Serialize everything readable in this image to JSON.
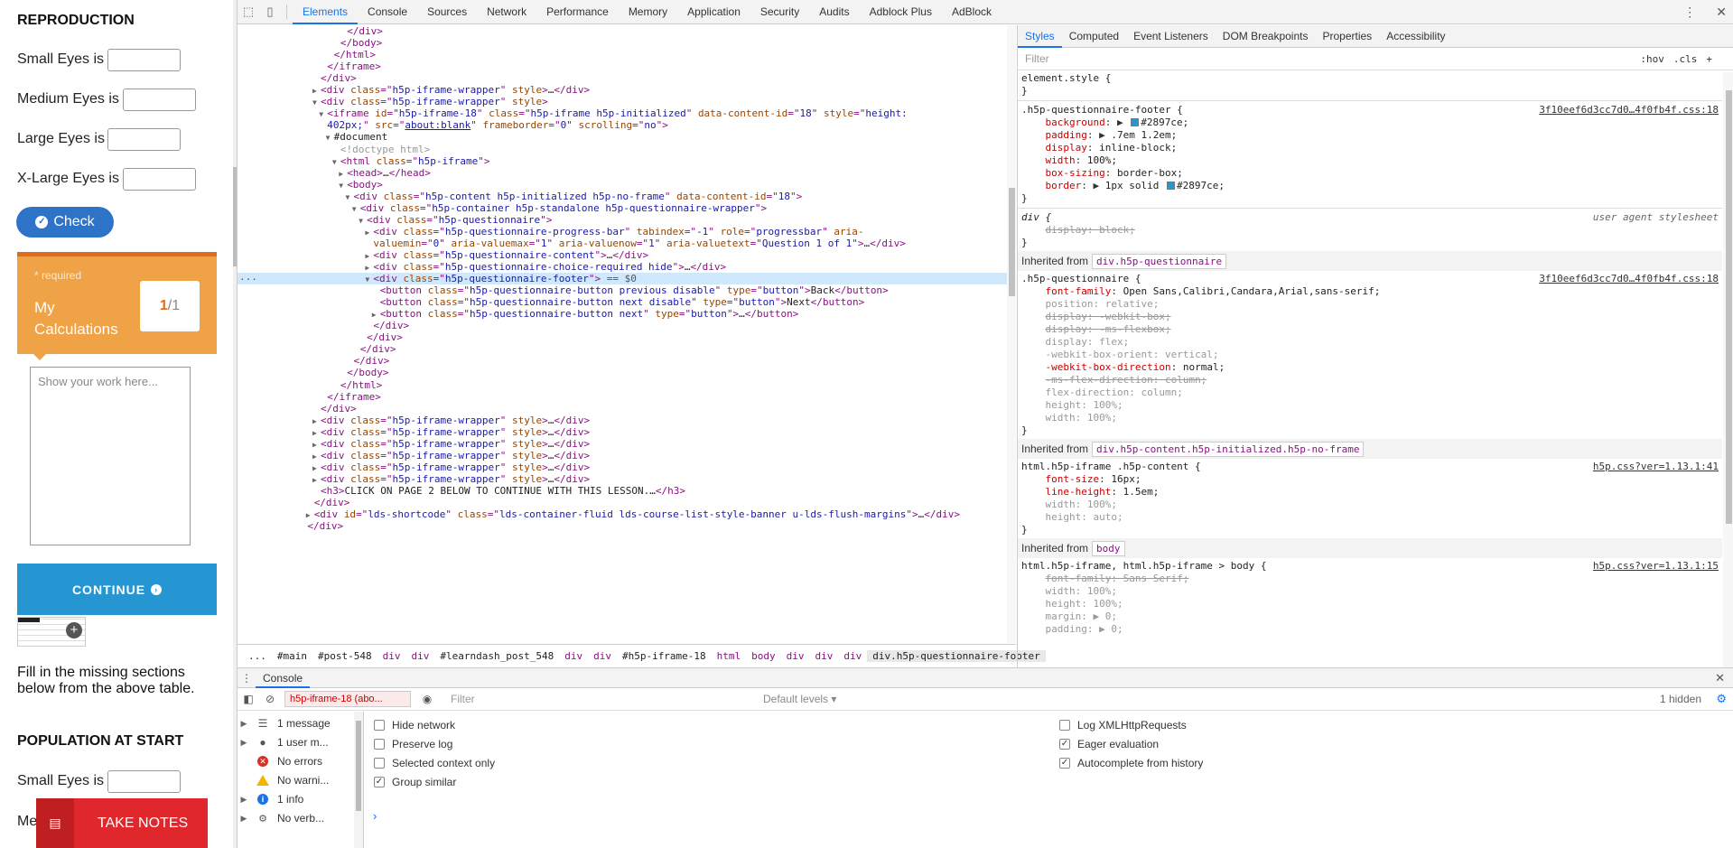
{
  "page": {
    "reproduction_heading": "REPRODUCTION",
    "rows": [
      {
        "label": "Small Eyes is",
        "value": ""
      },
      {
        "label": "Medium Eyes is",
        "value": ""
      },
      {
        "label": "Large Eyes is",
        "value": ""
      },
      {
        "label": "X-Large Eyes is",
        "value": ""
      }
    ],
    "check_label": "Check",
    "calc_card": {
      "required": "* required",
      "title": "My Calculations",
      "current": "1",
      "sep": "/",
      "total": "1"
    },
    "work_placeholder": "Show your work here...",
    "continue_label": "CONTINUE",
    "fill_text": "Fill in the missing sections below from the above table.",
    "population_heading": "POPULATION AT START",
    "pop_rows": [
      {
        "label": "Small Eyes is",
        "value": ""
      },
      {
        "label": "Me",
        "value": ""
      }
    ],
    "take_notes": "TAKE NOTES",
    "colors": {
      "check": "#2d74c9",
      "card": "#efa246",
      "card_top": "#e06a1e",
      "continue": "#2596d1",
      "notes": "#e0272b"
    }
  },
  "devtools": {
    "tabs": [
      "Elements",
      "Console",
      "Sources",
      "Network",
      "Performance",
      "Memory",
      "Application",
      "Security",
      "Audits",
      "Adblock Plus",
      "AdBlock"
    ],
    "active_tab": "Elements",
    "elements_lines": [
      {
        "indent": 14,
        "tri": "",
        "html": "<span class='tag'>&lt;/div&gt;</span>"
      },
      {
        "indent": 13,
        "tri": "",
        "html": "<span class='tag'>&lt;/body&gt;</span>"
      },
      {
        "indent": 12,
        "tri": "",
        "html": "<span class='tag'>&lt;/html&gt;</span>"
      },
      {
        "indent": 11,
        "tri": "",
        "html": "<span class='tag'>&lt;/iframe&gt;</span>"
      },
      {
        "indent": 10,
        "tri": "",
        "html": "<span class='tag'>&lt;/div&gt;</span>"
      },
      {
        "indent": 10,
        "tri": "▶",
        "html": "<span class='tag'>&lt;div</span> <span class='attr'>class</span>=\"<span class='val'>h5p-iframe-wrapper</span>\" <span class='attr'>style</span><span class='tag'>&gt;</span><span class='txt'>…</span><span class='tag'>&lt;/div&gt;</span>"
      },
      {
        "indent": 10,
        "tri": "▼",
        "html": "<span class='tag'>&lt;div</span> <span class='attr'>class</span>=\"<span class='val'>h5p-iframe-wrapper</span>\" <span class='attr'>style</span><span class='tag'>&gt;</span>"
      },
      {
        "indent": 11,
        "tri": "▼",
        "html": "<span class='tag'>&lt;iframe</span> <span class='attr'>id</span>=\"<span class='val'>h5p-iframe-18</span>\" <span class='attr'>class</span>=\"<span class='val'>h5p-iframe h5p-initialized</span>\" <span class='attr'>data-content-id</span>=\"<span class='val'>18</span>\" <span class='attr'>style</span>=\"<span class='val'>height:</span>"
      },
      {
        "indent": 11,
        "tri": "",
        "html": "<span class='val'>402px;</span>\" <span class='attr'>src</span>=\"<span class='val' style='text-decoration:underline'>about:blank</span>\" <span class='attr'>frameborder</span>=\"<span class='val'>0</span>\" <span class='attr'>scrolling</span>=\"<span class='val'>no</span>\"<span class='tag'>&gt;</span>"
      },
      {
        "indent": 12,
        "tri": "▼",
        "html": "<span class='txt'>#document</span>"
      },
      {
        "indent": 13,
        "tri": "",
        "html": "<span class='doct'>&lt;!doctype html&gt;</span>"
      },
      {
        "indent": 13,
        "tri": "▼",
        "html": "<span class='tag'>&lt;html</span> <span class='attr'>class</span>=\"<span class='val'>h5p-iframe</span>\"<span class='tag'>&gt;</span>"
      },
      {
        "indent": 14,
        "tri": "▶",
        "html": "<span class='tag'>&lt;head&gt;</span><span class='txt'>…</span><span class='tag'>&lt;/head&gt;</span>"
      },
      {
        "indent": 14,
        "tri": "▼",
        "html": "<span class='tag'>&lt;body&gt;</span>"
      },
      {
        "indent": 15,
        "tri": "▼",
        "html": "<span class='tag'>&lt;div</span> <span class='attr'>class</span>=\"<span class='val'>h5p-content h5p-initialized h5p-no-frame</span>\" <span class='attr'>data-content-id</span>=\"<span class='val'>18</span>\"<span class='tag'>&gt;</span>"
      },
      {
        "indent": 16,
        "tri": "▼",
        "html": "<span class='tag'>&lt;div</span> <span class='attr'>class</span>=\"<span class='val'>h5p-container h5p-standalone h5p-questionnaire-wrapper</span>\"<span class='tag'>&gt;</span>"
      },
      {
        "indent": 17,
        "tri": "▼",
        "html": "<span class='tag'>&lt;div</span> <span class='attr'>class</span>=\"<span class='val'>h5p-questionnaire</span>\"<span class='tag'>&gt;</span>"
      },
      {
        "indent": 18,
        "tri": "▶",
        "html": "<span class='tag'>&lt;div</span> <span class='attr'>class</span>=\"<span class='val'>h5p-questionnaire-progress-bar</span>\" <span class='attr'>tabindex</span>=\"<span class='val'>-1</span>\" <span class='attr'>role</span>=\"<span class='val'>progressbar</span>\" <span class='attr'>aria-</span>"
      },
      {
        "indent": 18,
        "tri": "",
        "html": "<span class='attr'>valuemin</span>=\"<span class='val'>0</span>\" <span class='attr'>aria-valuemax</span>=\"<span class='val'>1</span>\" <span class='attr'>aria-valuenow</span>=\"<span class='val'>1</span>\" <span class='attr'>aria-valuetext</span>=\"<span class='val'>Question 1 of 1</span>\"<span class='tag'>&gt;</span><span class='txt'>…</span><span class='tag'>&lt;/div&gt;</span>"
      },
      {
        "indent": 18,
        "tri": "▶",
        "html": "<span class='tag'>&lt;div</span> <span class='attr'>class</span>=\"<span class='val'>h5p-questionnaire-content</span>\"<span class='tag'>&gt;</span><span class='txt'>…</span><span class='tag'>&lt;/div&gt;</span>"
      },
      {
        "indent": 18,
        "tri": "▶",
        "html": "<span class='tag'>&lt;div</span> <span class='attr'>class</span>=\"<span class='val'>h5p-questionnaire-choice-required hide</span>\"<span class='tag'>&gt;</span><span class='txt'>…</span><span class='tag'>&lt;/div&gt;</span>"
      },
      {
        "indent": 18,
        "tri": "▼",
        "sel": true,
        "html": "<span class='tag'>&lt;div</span> <span class='attr'>class</span>=\"<span class='val'>h5p-questionnaire-footer</span>\"<span class='tag'>&gt;</span> <span class='eq'>== $0</span>"
      },
      {
        "indent": 19,
        "tri": "",
        "html": "<span class='tag'>&lt;button</span> <span class='attr'>class</span>=\"<span class='val'>h5p-questionnaire-button previous disable</span>\" <span class='attr'>type</span>=\"<span class='val'>button</span>\"<span class='tag'>&gt;</span><span class='txt'>Back</span><span class='tag'>&lt;/button&gt;</span>"
      },
      {
        "indent": 19,
        "tri": "",
        "html": "<span class='tag'>&lt;button</span> <span class='attr'>class</span>=\"<span class='val'>h5p-questionnaire-button next disable</span>\" <span class='attr'>type</span>=\"<span class='val'>button</span>\"<span class='tag'>&gt;</span><span class='txt'>Next</span><span class='tag'>&lt;/button&gt;</span>"
      },
      {
        "indent": 19,
        "tri": "▶",
        "html": "<span class='tag'>&lt;button</span> <span class='attr'>class</span>=\"<span class='val'>h5p-questionnaire-button next</span>\" <span class='attr'>type</span>=\"<span class='val'>button</span>\"<span class='tag'>&gt;</span><span class='txt'>…</span><span class='tag'>&lt;/button&gt;</span>"
      },
      {
        "indent": 18,
        "tri": "",
        "html": "<span class='tag'>&lt;/div&gt;</span>"
      },
      {
        "indent": 17,
        "tri": "",
        "html": "<span class='tag'>&lt;/div&gt;</span>"
      },
      {
        "indent": 16,
        "tri": "",
        "html": "<span class='tag'>&lt;/div&gt;</span>"
      },
      {
        "indent": 15,
        "tri": "",
        "html": "<span class='tag'>&lt;/div&gt;</span>"
      },
      {
        "indent": 14,
        "tri": "",
        "html": "<span class='tag'>&lt;/body&gt;</span>"
      },
      {
        "indent": 13,
        "tri": "",
        "html": "<span class='tag'>&lt;/html&gt;</span>"
      },
      {
        "indent": 11,
        "tri": "",
        "html": "<span class='tag'>&lt;/iframe&gt;</span>"
      },
      {
        "indent": 10,
        "tri": "",
        "html": "<span class='tag'>&lt;/div&gt;</span>"
      },
      {
        "indent": 10,
        "tri": "▶",
        "html": "<span class='tag'>&lt;div</span> <span class='attr'>class</span>=\"<span class='val'>h5p-iframe-wrapper</span>\" <span class='attr'>style</span><span class='tag'>&gt;</span><span class='txt'>…</span><span class='tag'>&lt;/div&gt;</span>"
      },
      {
        "indent": 10,
        "tri": "▶",
        "html": "<span class='tag'>&lt;div</span> <span class='attr'>class</span>=\"<span class='val'>h5p-iframe-wrapper</span>\" <span class='attr'>style</span><span class='tag'>&gt;</span><span class='txt'>…</span><span class='tag'>&lt;/div&gt;</span>"
      },
      {
        "indent": 10,
        "tri": "▶",
        "html": "<span class='tag'>&lt;div</span> <span class='attr'>class</span>=\"<span class='val'>h5p-iframe-wrapper</span>\" <span class='attr'>style</span><span class='tag'>&gt;</span><span class='txt'>…</span><span class='tag'>&lt;/div&gt;</span>"
      },
      {
        "indent": 10,
        "tri": "▶",
        "html": "<span class='tag'>&lt;div</span> <span class='attr'>class</span>=\"<span class='val'>h5p-iframe-wrapper</span>\" <span class='attr'>style</span><span class='tag'>&gt;</span><span class='txt'>…</span><span class='tag'>&lt;/div&gt;</span>"
      },
      {
        "indent": 10,
        "tri": "▶",
        "html": "<span class='tag'>&lt;div</span> <span class='attr'>class</span>=\"<span class='val'>h5p-iframe-wrapper</span>\" <span class='attr'>style</span><span class='tag'>&gt;</span><span class='txt'>…</span><span class='tag'>&lt;/div&gt;</span>"
      },
      {
        "indent": 10,
        "tri": "▶",
        "html": "<span class='tag'>&lt;div</span> <span class='attr'>class</span>=\"<span class='val'>h5p-iframe-wrapper</span>\" <span class='attr'>style</span><span class='tag'>&gt;</span><span class='txt'>…</span><span class='tag'>&lt;/div&gt;</span>"
      },
      {
        "indent": 10,
        "tri": "",
        "html": "<span class='tag'>&lt;h3&gt;</span><span class='txt'>CLICK ON PAGE 2 BELOW TO CONTINUE WITH THIS LESSON.</span><span class='txt'>…</span><span class='tag'>&lt;/h3&gt;</span>"
      },
      {
        "indent": 9,
        "tri": "",
        "html": "<span class='tag'>&lt;/div&gt;</span>"
      },
      {
        "indent": 9,
        "tri": "▶",
        "html": "<span class='tag'>&lt;div</span> <span class='attr'>id</span>=\"<span class='val'>lds-shortcode</span>\" <span class='attr'>class</span>=\"<span class='val'>lds-container-fluid lds-course-list-style-banner u-lds-flush-margins</span>\"<span class='tag'>&gt;</span><span class='txt'>…</span><span class='tag'>&lt;/div&gt;</span>"
      },
      {
        "indent": 8,
        "tri": "",
        "html": "<span class='tag'>&lt;/div&gt;</span>"
      }
    ],
    "breadcrumbs": [
      {
        "t": "...",
        "c": "plain"
      },
      {
        "t": "#main",
        "c": "plain"
      },
      {
        "t": "#post-548",
        "c": "plain"
      },
      {
        "t": "div",
        "c": ""
      },
      {
        "t": "div",
        "c": ""
      },
      {
        "t": "#learndash_post_548",
        "c": "plain"
      },
      {
        "t": "div",
        "c": ""
      },
      {
        "t": "div",
        "c": ""
      },
      {
        "t": "#h5p-iframe-18",
        "c": "plain"
      },
      {
        "t": "html",
        "c": ""
      },
      {
        "t": "body",
        "c": ""
      },
      {
        "t": "div",
        "c": ""
      },
      {
        "t": "div",
        "c": ""
      },
      {
        "t": "div",
        "c": ""
      },
      {
        "t": "div.h5p-questionnaire-footer",
        "c": "sel"
      }
    ],
    "styles_tabs": [
      "Styles",
      "Computed",
      "Event Listeners",
      "DOM Breakpoints",
      "Properties",
      "Accessibility"
    ],
    "styles_filter": "Filter",
    "styles_hov": ":hov",
    "styles_cls": ".cls",
    "styles_plus": "+",
    "styles_lines": [
      {
        "k": "line",
        "html": "<span class='ssel'>element.style {</span>"
      },
      {
        "k": "line",
        "html": "<span class='ssel'>}</span>"
      },
      {
        "k": "div"
      },
      {
        "k": "line",
        "html": "<span class='ssel'>.h5p-questionnaire-footer {</span>",
        "link": "3f10eef6d3cc7d0…4f0fb4f.css:18"
      },
      {
        "k": "line",
        "html": "    <span class='sprop'>background</span>: ▶ <span class='swatch'></span><span class='sval'>#2897ce;</span>"
      },
      {
        "k": "line",
        "html": "    <span class='sprop'>padding</span>: ▶ <span class='sval'>.7em 1.2em;</span>"
      },
      {
        "k": "line",
        "html": "    <span class='sprop'>display</span>: <span class='sval'>inline-block;</span>"
      },
      {
        "k": "line",
        "html": "    <span class='sprop'>width</span>: <span class='sval'>100%;</span>"
      },
      {
        "k": "line",
        "html": "    <span class='sprop'>box-sizing</span>: <span class='sval'>border-box;</span>"
      },
      {
        "k": "line",
        "html": "    <span class='sprop'>border</span>: ▶ <span class='sval'>1px solid</span> <span class='swatch'></span><span class='sval'>#2897ce;</span>"
      },
      {
        "k": "line",
        "html": "<span class='ssel'>}</span>"
      },
      {
        "k": "div"
      },
      {
        "k": "line",
        "html": "<span class='ssel' style='font-style:italic'>div {</span>",
        "ua": "user agent stylesheet"
      },
      {
        "k": "line",
        "html": "    <span class='sstrike'>display: block;</span>"
      },
      {
        "k": "line",
        "html": "<span class='ssel'>}</span>"
      },
      {
        "k": "inh",
        "label": "Inherited from",
        "pill": "div.h5p-questionnaire"
      },
      {
        "k": "line",
        "html": "<span class='ssel'>.h5p-questionnaire {</span>",
        "link": "3f10eef6d3cc7d0…4f0fb4f.css:18"
      },
      {
        "k": "line",
        "html": "    <span class='sprop'>font-family</span>: <span class='sval'>Open Sans,Calibri,Candara,Arial,sans-serif;</span>"
      },
      {
        "k": "line",
        "html": "    <span class='sstrike' style='text-decoration:none'>position: relative;</span>"
      },
      {
        "k": "line",
        "html": "    <span class='sstrike'>display: -webkit-box;</span>"
      },
      {
        "k": "line",
        "html": "    <span class='sstrike'>display: -ms-flexbox;</span>"
      },
      {
        "k": "line",
        "html": "    <span class='sstrike' style='text-decoration:none'>display: flex;</span>"
      },
      {
        "k": "line",
        "html": "    <span class='sstrike' style='text-decoration:none'>-webkit-box-orient: vertical;</span>"
      },
      {
        "k": "line",
        "html": "    <span class='sprop'>-webkit-box-direction</span>: <span class='sval'>normal;</span>"
      },
      {
        "k": "line",
        "html": "    <span class='sstrike'>-ms-flex-direction: column;</span>"
      },
      {
        "k": "line",
        "html": "    <span class='sstrike' style='text-decoration:none'>flex-direction: column;</span>"
      },
      {
        "k": "line",
        "html": "    <span class='sstrike' style='text-decoration:none'>height: 100%;</span>"
      },
      {
        "k": "line",
        "html": "    <span class='sstrike' style='text-decoration:none'>width: 100%;</span>"
      },
      {
        "k": "line",
        "html": "<span class='ssel'>}</span>"
      },
      {
        "k": "inh",
        "label": "Inherited from",
        "pill": "div.h5p-content.h5p-initialized.h5p-no-frame"
      },
      {
        "k": "line",
        "html": "<span class='ssel'>html.h5p-iframe .h5p-content {</span>",
        "link": "h5p.css?ver=1.13.1:41"
      },
      {
        "k": "line",
        "html": "    <span class='sprop'>font-size</span>: <span class='sval'>16px;</span>"
      },
      {
        "k": "line",
        "html": "    <span class='sprop'>line-height</span>: <span class='sval'>1.5em;</span>"
      },
      {
        "k": "line",
        "html": "    <span class='sstrike' style='text-decoration:none'>width: 100%;</span>"
      },
      {
        "k": "line",
        "html": "    <span class='sstrike' style='text-decoration:none'>height: auto;</span>"
      },
      {
        "k": "line",
        "html": "<span class='ssel'>}</span>"
      },
      {
        "k": "inh",
        "label": "Inherited from",
        "pill": "body"
      },
      {
        "k": "line",
        "html": "<span class='ssel'>html.h5p-iframe, html.h5p-iframe &gt; body {</span>",
        "link": "h5p.css?ver=1.13.1:15"
      },
      {
        "k": "line",
        "html": "    <span class='sstrike'>font-family: Sans Serif;</span>"
      },
      {
        "k": "line",
        "html": "    <span class='sstrike' style='text-decoration:none'>width: 100%;</span>"
      },
      {
        "k": "line",
        "html": "    <span class='sstrike' style='text-decoration:none'>height: 100%;</span>"
      },
      {
        "k": "line",
        "html": "    <span class='sstrike' style='text-decoration:none'>margin: ▶ 0;</span>"
      },
      {
        "k": "line",
        "html": "    <span class='sstrike' style='text-decoration:none'>padding: ▶ 0;</span>"
      }
    ],
    "console": {
      "tab": "Console",
      "context": "h5p-iframe-18 (abo...",
      "filter_placeholder": "Filter",
      "levels": "Default levels ▾",
      "hidden": "1 hidden",
      "sidebar": [
        {
          "label": "1 message",
          "icon": "list"
        },
        {
          "label": "1 user m...",
          "icon": "user"
        },
        {
          "label": "No errors",
          "icon": "error"
        },
        {
          "label": "No warni...",
          "icon": "warning"
        },
        {
          "label": "1 info",
          "icon": "info"
        },
        {
          "label": "No verb...",
          "icon": "verbose"
        }
      ],
      "options_left": [
        {
          "label": "Hide network",
          "checked": false
        },
        {
          "label": "Preserve log",
          "checked": false
        },
        {
          "label": "Selected context only",
          "checked": false
        },
        {
          "label": "Group similar",
          "checked": true
        }
      ],
      "options_right": [
        {
          "label": "Log XMLHttpRequests",
          "checked": false
        },
        {
          "label": "Eager evaluation",
          "checked": true
        },
        {
          "label": "Autocomplete from history",
          "checked": true
        }
      ]
    }
  }
}
